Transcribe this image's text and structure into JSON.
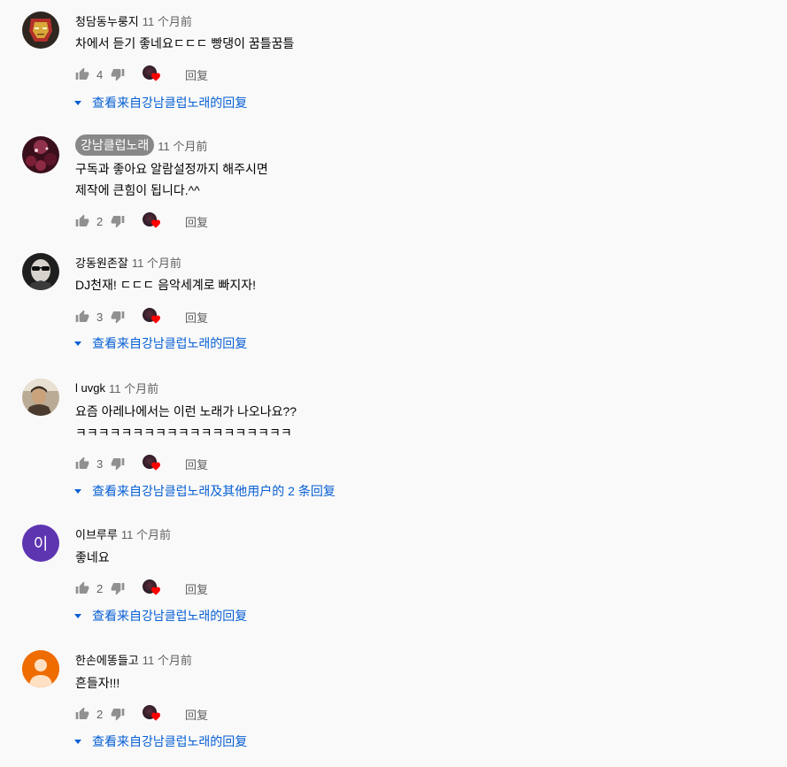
{
  "comments": [
    {
      "author": "청담동누룽지",
      "time": "11 个月前",
      "lines": [
        "차에서 듣기 좋네요ㄷㄷㄷ 빵댕이 꿈틀꿈틀"
      ],
      "likes": "4",
      "reply": "回复",
      "view_replies": "查看来自강남클럽노래的回复",
      "avatar_icon": "iron-man-avatar",
      "avatar_color": "#3a2d22"
    },
    {
      "author": "강남클럽노래",
      "time": "11 个月前",
      "lines": [
        "구독과 좋아요 알람설정까지 해주시면",
        "제작에 큰힘이 됩니다.^^"
      ],
      "likes": "2",
      "reply": "回复",
      "avatar_icon": "club-crowd-avatar",
      "avatar_color": "#4a1d28"
    },
    {
      "author": "강동원존잘",
      "time": "11 个月前",
      "lines": [
        "DJ천재! ㄷㄷㄷ 음악세계로 빠지자!"
      ],
      "likes": "3",
      "reply": "回复",
      "view_replies": "查看来自강남클럽노래的回复",
      "avatar_icon": "sunglasses-man-avatar",
      "avatar_color": "#2b2b2b"
    },
    {
      "author": "l uvgk",
      "time": "11 个月前",
      "lines": [
        "요즘 아레나에서는 이런 노래가  나오나요??",
        "ㅋㅋㅋㅋㅋㅋㅋㅋㅋㅋㅋㅋㅋㅋㅋㅋㅋㅋㅋ"
      ],
      "likes": "3",
      "reply": "回复",
      "view_replies": "查看来自강남클럽노래及其他用户的 2 条回复",
      "avatar_icon": "person-photo-avatar",
      "avatar_color": "#8a7a66"
    },
    {
      "author": "이브루루",
      "time": "11 个月前",
      "lines": [
        "좋네요"
      ],
      "likes": "2",
      "reply": "回复",
      "view_replies": "查看来自강남클럽노래的回复",
      "avatar_letter": "이",
      "avatar_color": "#5e35b1"
    },
    {
      "author": "한손에똥들고",
      "time": "11 个月前",
      "lines": [
        "흔들자!!!"
      ],
      "likes": "2",
      "reply": "回复",
      "view_replies": "查看来自강남클럽노래的回复",
      "avatar_icon": "default-person-avatar",
      "avatar_color": "#ef6c00"
    }
  ],
  "colors": {
    "background": "#f9f9f9",
    "link": "#065fd4",
    "secondary_text": "#606060",
    "heart": "#ff0000"
  }
}
